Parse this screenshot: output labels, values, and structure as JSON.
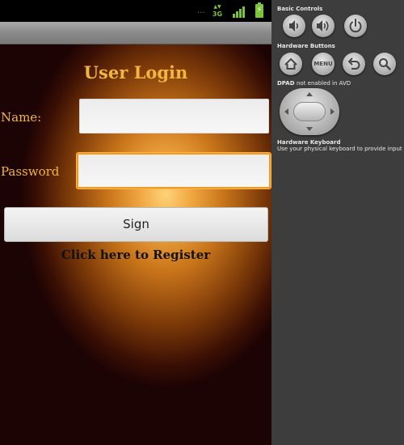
{
  "app": {
    "title": "User Login",
    "name_label": "Name:",
    "password_label": "Password",
    "name_value": "",
    "password_value": "",
    "sign_label": "Sign",
    "register_link": "Click here to Register"
  },
  "status_bar": {
    "dots": "...",
    "network": "3G",
    "network_icon": "3g-data-icon",
    "signal_icon": "signal-strength-icon",
    "battery_icon": "battery-charging-icon"
  },
  "controls_panel": {
    "basic_controls_title": "Basic Controls",
    "basic_controls": [
      {
        "name": "volume-down-icon"
      },
      {
        "name": "volume-up-icon"
      },
      {
        "name": "power-icon"
      }
    ],
    "hardware_buttons_title": "Hardware Buttons",
    "hardware_buttons": [
      {
        "name": "home-icon"
      },
      {
        "name": "menu-icon",
        "label": "MENU"
      },
      {
        "name": "back-icon"
      },
      {
        "name": "search-icon"
      }
    ],
    "dpad_title": "DPAD",
    "dpad_note": "not enabled in AVD",
    "keyboard_title": "Hardware Keyboard",
    "keyboard_note": "Use your physical keyboard to provide input"
  },
  "colors": {
    "title_gold": "#f2b640",
    "status_green": "#7cc33a",
    "input_focus": "#f29b1d",
    "panel_bg": "#3d3d3d"
  }
}
